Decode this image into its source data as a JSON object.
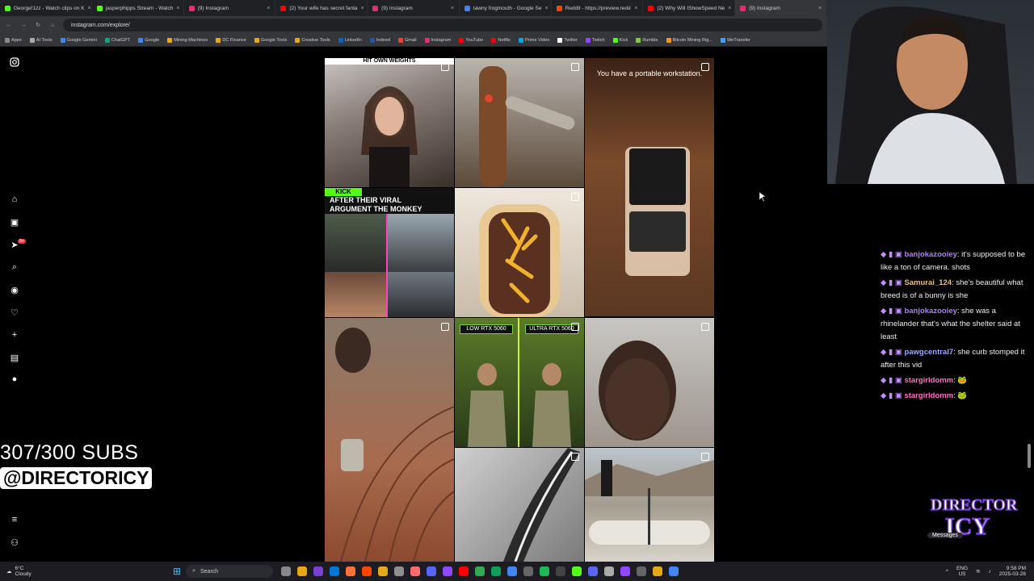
{
  "browser": {
    "tabs": [
      {
        "label": "George!1zz - Watch clips on K",
        "color": "#53fc18"
      },
      {
        "label": "jasperphipps Stream - Watch",
        "color": "#53fc18"
      },
      {
        "label": "(9) Instagram",
        "color": "#e1306c"
      },
      {
        "label": "(2) Your wife has secret fanta",
        "color": "#ff0000"
      },
      {
        "label": "(9) Instagram",
        "color": "#e1306c"
      },
      {
        "label": "tawny frogmouth - Google Se",
        "color": "#4285f4"
      },
      {
        "label": "Reddit - https://preview.redd",
        "color": "#ff4500"
      },
      {
        "label": "(2) Why Will IShowSpeed Ne",
        "color": "#ff0000"
      },
      {
        "label": "(9) Instagram",
        "color": "#e1306c"
      }
    ],
    "url": "instagram.com/explore/",
    "bookmarks": [
      "Apps",
      "AI Tools",
      "Google Gemini",
      "ChatGPT",
      "Google",
      "Mining Machines",
      "DC Finance",
      "Google Tools",
      "Creative Tools",
      "LinkedIn",
      "Indeed",
      "Gmail",
      "Instagram",
      "YouTube",
      "Netflix",
      "Prime Video",
      "Twitter",
      "Twitch",
      "Kick",
      "Rumble",
      "Bitcoin Mining Rig...",
      "WeTransfer"
    ]
  },
  "sidebar": {
    "items": [
      "instagram-icon",
      "home-icon",
      "reels-icon",
      "messages-icon",
      "search-icon",
      "explore-icon",
      "heart-icon",
      "create-icon",
      "dashboard-icon",
      "profile-icon",
      "menu-icon",
      "meta-icon"
    ],
    "notification_count": "9+"
  },
  "grid": {
    "cells": [
      {
        "caption": "HIT OWN WEIGHTS"
      },
      {
        "caption": ""
      },
      {
        "caption": "You have a portable workstation."
      },
      {
        "caption": "AFTER THEIR VIRAL ARGUMENT THE MONKEY APP MONTHS AGO"
      },
      {
        "caption": ""
      },
      {
        "caption": ""
      },
      {
        "caption": "LOW RTX 5060"
      },
      {
        "caption": "ULTRA RTX 5060"
      },
      {
        "caption": ""
      },
      {
        "caption": ""
      },
      {
        "caption": ""
      },
      {
        "caption": ""
      }
    ],
    "kick_label": "KICK"
  },
  "chat": {
    "messages": [
      {
        "user": "banjokazooiey",
        "color": "#b07cff",
        "text": ": it's supposed to be like a ton of camera. shots"
      },
      {
        "user": "Samurai_124",
        "color": "#e5c07b",
        "text": ": she's beautiful what breed is of a bunny is she"
      },
      {
        "user": "banjokazooiey",
        "color": "#b07cff",
        "text": ": she was a rhinelander that's what the shelter said at least"
      },
      {
        "user": "pawgcentral7",
        "color": "#a0a8ff",
        "text": ": she curb stomped it after this vid"
      },
      {
        "user": "stargirldomm",
        "color": "#ff6ec7",
        "text": ": 🐸"
      },
      {
        "user": "stargirldomm",
        "color": "#ff6ec7",
        "text": ": 🐸"
      }
    ]
  },
  "overlay": {
    "sub_count": "307/300 SUBS",
    "handle": "@DIRECTORICY",
    "logo_text": "DIRECTOR ICY",
    "messages_label": "Messages"
  },
  "taskbar": {
    "weather_temp": "6°C",
    "weather_desc": "Cloudy",
    "search_placeholder": "Search",
    "lang": "ENG",
    "region": "US",
    "time": "9:58 PM",
    "date": "2025-03-26"
  }
}
